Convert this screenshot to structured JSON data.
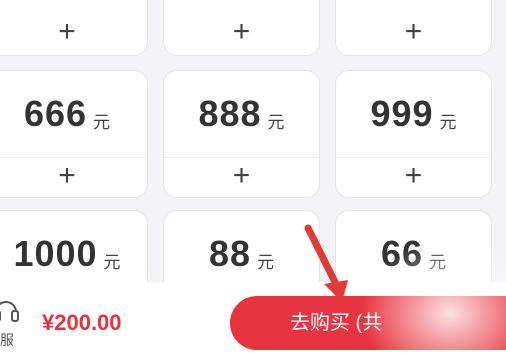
{
  "cards": [
    {
      "amount": "",
      "unit": "",
      "add": "+"
    },
    {
      "amount": "",
      "unit": "",
      "add": "+"
    },
    {
      "amount": "",
      "unit": "",
      "add": "+"
    },
    {
      "amount": "666",
      "unit": "元",
      "add": "+"
    },
    {
      "amount": "888",
      "unit": "元",
      "add": "+"
    },
    {
      "amount": "999",
      "unit": "元",
      "add": "+"
    },
    {
      "amount": "1000",
      "unit": "元"
    },
    {
      "amount": "88",
      "unit": "元"
    },
    {
      "amount": "66",
      "unit": "元"
    }
  ],
  "bottom_bar": {
    "service_label": "服",
    "total_price": "¥200.00",
    "buy_button_label": "去购买 (共"
  },
  "colors": {
    "accent": "#e8343f",
    "price": "#e8333f",
    "arrow": "#e23a36"
  }
}
